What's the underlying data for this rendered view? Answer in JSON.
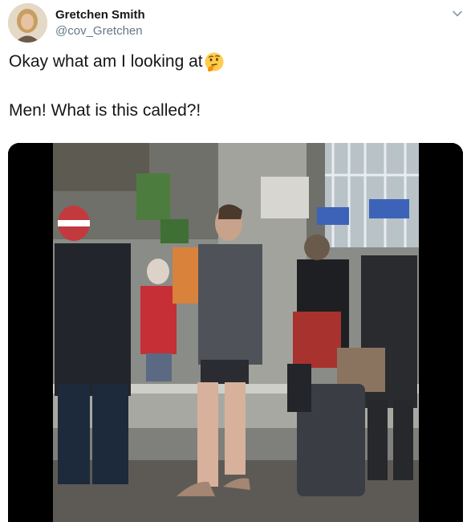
{
  "author": {
    "display_name": "Gretchen Smith",
    "handle": "@cov_Gretchen"
  },
  "tweet": {
    "line1": "Okay what am I looking at",
    "line1_emoji": "thinking-face-emoji",
    "line2": "Men! What is this called?!"
  },
  "icons": {
    "menu": "chevron-down-icon"
  },
  "media": {
    "kind": "video-still"
  }
}
